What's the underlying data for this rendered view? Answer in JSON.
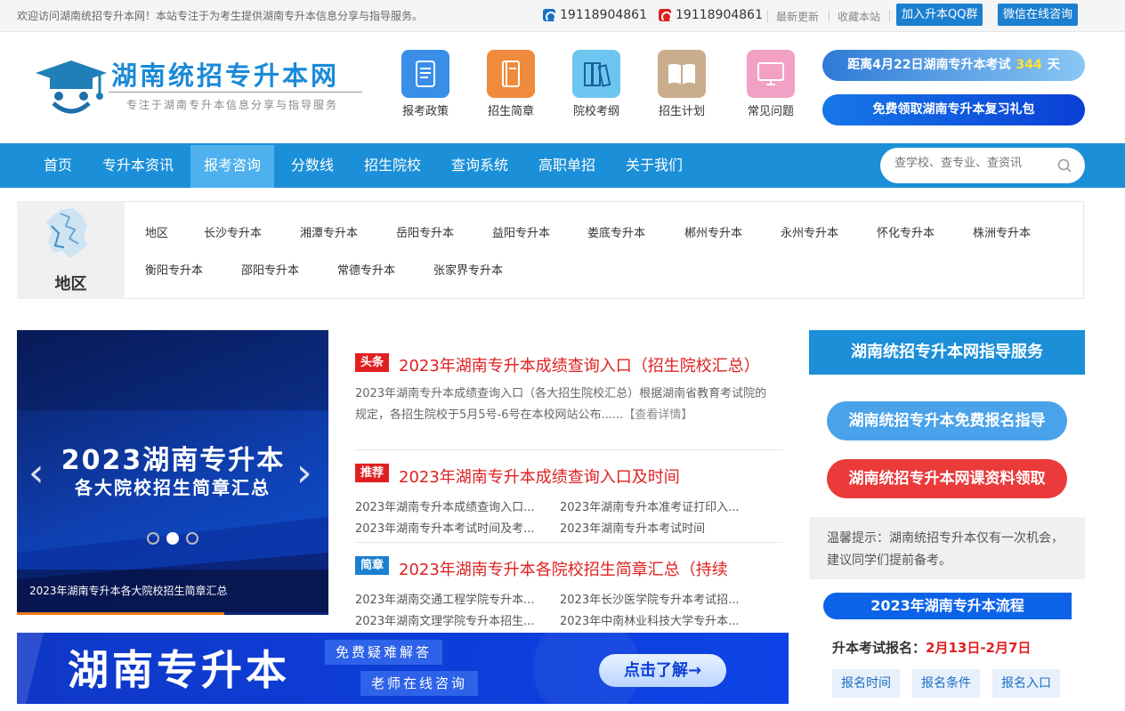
{
  "topbar": {
    "welcome": "欢迎访问湖南统招专升本网！本站专注于为考生提供湖南专升本信息分享与指导服务。",
    "phone1": "19118904861",
    "phone2": "19118904861",
    "latest": "最新更新",
    "favorite": "收藏本站",
    "qq_btn": "加入升本QQ群",
    "wechat_btn": "微信在线咨询"
  },
  "header": {
    "site_name": "湖南统招专升本网",
    "slogan": "专注于湖南专升本信息分享与指导服务",
    "icons": [
      {
        "label": "报考政策",
        "icon": "scroll-icon",
        "color": "#3a8ee8"
      },
      {
        "label": "招生简章",
        "icon": "book-icon",
        "color": "#f08a3c"
      },
      {
        "label": "院校考纲",
        "icon": "binders-icon",
        "color": "#6cc6f0"
      },
      {
        "label": "招生计划",
        "icon": "open-book-icon",
        "color": "#c9ad8c"
      },
      {
        "label": "常见问题",
        "icon": "monitor-icon",
        "color": "#f2a0c4"
      }
    ],
    "countdown_prefix": "距离4月22日湖南专升本考试",
    "countdown_days": "344",
    "countdown_unit": "天",
    "gift": "免费领取湖南专升本复习礼包"
  },
  "nav": {
    "items": [
      "首页",
      "专升本资讯",
      "报考咨询",
      "分数线",
      "招生院校",
      "查询系统",
      "高职单招",
      "关于我们"
    ],
    "active": "报考咨询",
    "search_placeholder": "查学校、查专业、查资讯"
  },
  "region": {
    "title": "地区",
    "links": [
      "地区",
      "长沙专升本",
      "湘潭专升本",
      "岳阳专升本",
      "益阳专升本",
      "娄底专升本",
      "郴州专升本",
      "永州专升本",
      "怀化专升本",
      "株洲专升本",
      "衡阳专升本",
      "邵阳专升本",
      "常德专升本",
      "张家界专升本"
    ]
  },
  "carousel": {
    "line1": "2023湖南专升本",
    "line2": "各大院校招生简章汇总",
    "caption": "2023年湖南专升本各大院校招生简章汇总",
    "slide_count": 3,
    "active_slide": 2
  },
  "news": {
    "headline": {
      "tag": "头条",
      "title": "2023年湖南专升本成绩查询入口（招生院校汇总）",
      "desc": "2023年湖南专升本成绩查询入口（各大招生院校汇总）根据湖南省教育考试院的规定，各招生院校于5月5号-6号在本校网站公布......",
      "more": "【查看详情】"
    },
    "recommend": {
      "tag": "推荐",
      "title": "2023年湖南专升本成绩查询入口及时间",
      "subs": [
        "2023年湖南专升本成绩查询入口...",
        "2023年湖南专升本准考证打印入...",
        "2023年湖南专升本考试时间及考...",
        "2023年湖南专升本考试时间"
      ]
    },
    "brochure": {
      "tag": "简章",
      "title": "2023年湖南专升本各院校招生简章汇总（持续",
      "subs": [
        "2023年湖南交通工程学院专升本...",
        "2023年长沙医学院专升本考试招...",
        "2023年湖南文理学院专升本招生...",
        "2023年中南林业科技大学专升本..."
      ]
    }
  },
  "banner": {
    "main": "湖南专升本",
    "tag1": "免费疑难解答",
    "tag2": "老师在线咨询",
    "cta": "点击了解→"
  },
  "service": {
    "title": "湖南统招专升本网指导服务",
    "btn1": "湖南统招专升本免费报名指导",
    "btn2": "湖南统招专升本网课资料领取",
    "tip": "温馨提示：湖南统招专升本仅有一次机会，建议同学们提前备考。"
  },
  "flow": {
    "title": "2023年湖南专升本流程",
    "label": "升本考试报名：",
    "date": "2月13日-2月7日",
    "buttons": [
      "报名时间",
      "报名条件",
      "报名入口"
    ]
  },
  "colors": {
    "brand_blue": "#1b8fd8",
    "active_nav": "#4eb1ee",
    "red": "#e02020"
  }
}
